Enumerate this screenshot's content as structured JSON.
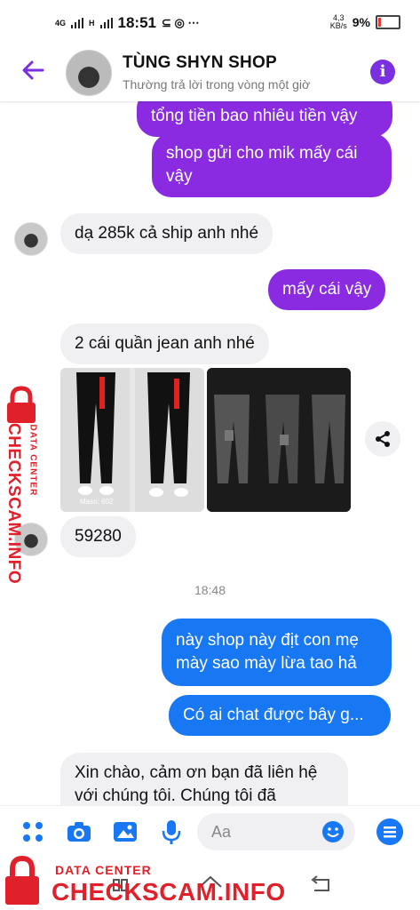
{
  "status_bar": {
    "network": "4G",
    "network2": "H",
    "time": "18:51",
    "speed_value": "4,3",
    "speed_unit": "KB/s",
    "battery": "9%"
  },
  "header": {
    "title": "TÙNG SHYN SHOP",
    "subtitle": "Thường trả lời trong vòng một giờ",
    "info_glyph": "i"
  },
  "messages": [
    {
      "side": "out",
      "color": "purple",
      "text": "tổng tiền bao nhiêu tiền vậy"
    },
    {
      "side": "out",
      "color": "purple",
      "text": "shop gửi cho mik mấy cái vậy"
    },
    {
      "side": "in",
      "text": "dạ 285k cả ship anh nhé"
    },
    {
      "side": "out",
      "color": "purple",
      "text": "mấy cái vậy"
    },
    {
      "side": "in",
      "text": "2 cái quần jean anh nhé"
    },
    {
      "side": "in",
      "text": "59280"
    },
    {
      "side": "out",
      "color": "blue",
      "text": "này shop này địt con mẹ mày sao mày lừa tao hả"
    },
    {
      "side": "out",
      "color": "blue",
      "text": "Có ai chat được bây g..."
    },
    {
      "side": "in",
      "text": "Xin chào, cảm ơn bạn đã liên hệ với chúng tôi. Chúng tôi đã"
    }
  ],
  "photo": {
    "caption": "Maso: 602"
  },
  "timestamp": "18:48",
  "composer": {
    "placeholder": "Aa"
  },
  "watermark": {
    "line1": "DATA CENTER",
    "line2": "CHECKSCAM.INFO"
  },
  "colors": {
    "purple": "#8a2be2",
    "blue": "#1877f2",
    "incoming": "#f0f0f3",
    "watermark": "#e0202a"
  }
}
